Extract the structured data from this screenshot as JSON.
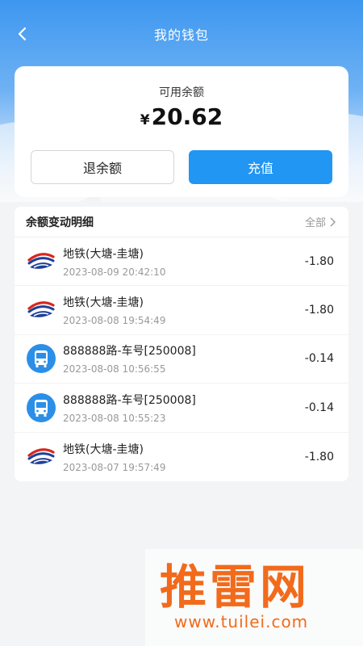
{
  "header": {
    "title": "我的钱包"
  },
  "balance": {
    "label": "可用余额",
    "currency": "¥",
    "amount": "20.62",
    "refund_label": "退余额",
    "recharge_label": "充值"
  },
  "history": {
    "title": "余额变动明细",
    "all_label": "全部",
    "items": [
      {
        "icon": "metro-logo-icon",
        "name": "地铁(大塘-圭塘)",
        "time": "2023-08-09 20:42:10",
        "amount": "-1.80"
      },
      {
        "icon": "metro-logo-icon",
        "name": "地铁(大塘-圭塘)",
        "time": "2023-08-08 19:54:49",
        "amount": "-1.80"
      },
      {
        "icon": "bus-icon",
        "name": "888888路-车号[250008]",
        "time": "2023-08-08 10:56:55",
        "amount": "-0.14"
      },
      {
        "icon": "bus-icon",
        "name": "888888路-车号[250008]",
        "time": "2023-08-08 10:55:23",
        "amount": "-0.14"
      },
      {
        "icon": "metro-logo-icon",
        "name": "地铁(大塘-圭塘)",
        "time": "2023-08-07 19:57:49",
        "amount": "-1.80"
      }
    ]
  },
  "watermark": {
    "main": "推雷网",
    "sub": "www.tuilei.com"
  },
  "colors": {
    "accent": "#2196f3",
    "header_bg": "#3d97f0",
    "watermark": "#f26a1b"
  }
}
